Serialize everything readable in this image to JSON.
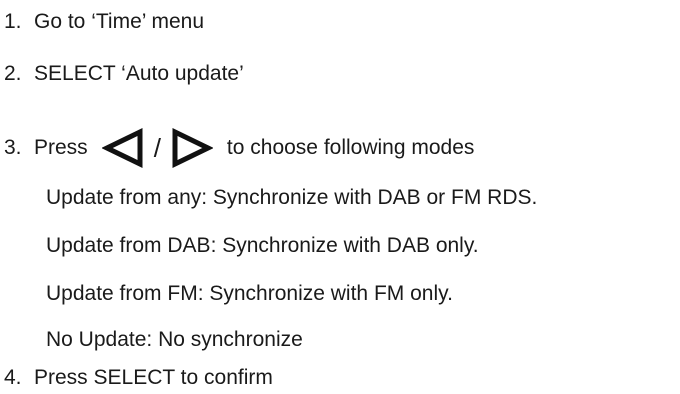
{
  "steps": [
    {
      "number": "1.",
      "text": "Go to ‘Time’ menu"
    },
    {
      "number": "2.",
      "text": "SELECT ‘Auto update’"
    },
    {
      "number": "3.",
      "text_before": "Press",
      "separator": "/",
      "text_after": "to choose following modes"
    },
    {
      "number": "4.",
      "text": "Press SELECT to confirm"
    }
  ],
  "modes": [
    "Update from any: Synchronize with DAB or FM RDS.",
    "Update from DAB: Synchronize with DAB only.",
    "Update from FM: Synchronize with FM only.",
    "No Update: No synchronize"
  ],
  "icons": {
    "left": "left-triangle-icon",
    "right": "right-triangle-icon"
  }
}
